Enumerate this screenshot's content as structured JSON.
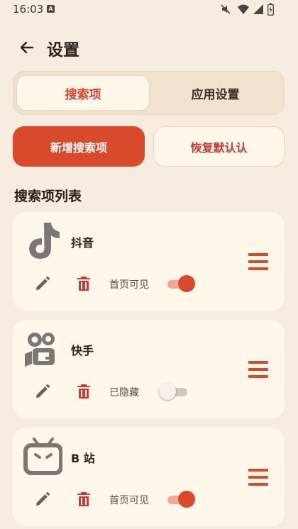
{
  "status_bar": {
    "time": "16:03",
    "sim_badge": "A"
  },
  "header": {
    "title": "设置"
  },
  "tabs": [
    {
      "label": "搜索项",
      "selected": true
    },
    {
      "label": "应用设置",
      "selected": false
    }
  ],
  "actions": {
    "add_label": "新增搜索项",
    "restore_label": "恢复默认认"
  },
  "section_title": "搜索项列表",
  "items": [
    {
      "name": "抖音",
      "icon": "tiktok-icon",
      "visibility": "首页可见",
      "enabled": true
    },
    {
      "name": "快手",
      "icon": "kuaishou-icon",
      "visibility": "已隐藏",
      "enabled": false
    },
    {
      "name": "B 站",
      "icon": "bilibili-icon",
      "visibility": "首页可见",
      "enabled": true
    }
  ],
  "colors": {
    "accent": "#d94a2a",
    "background": "#f6ecdf",
    "card": "#fef7ea"
  }
}
